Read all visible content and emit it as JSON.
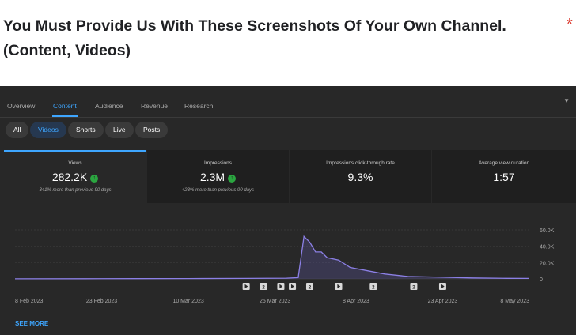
{
  "question": {
    "text": "You Must Provide Us With These Screenshots Of Your Own Channel. (Content, Videos)",
    "required_mark": "*"
  },
  "studio": {
    "tabs": [
      "Overview",
      "Content",
      "Audience",
      "Revenue",
      "Research"
    ],
    "active_tab": "Content",
    "chips": [
      "All",
      "Videos",
      "Shorts",
      "Live",
      "Posts"
    ],
    "active_chip": "Videos",
    "metrics": [
      {
        "title": "Views",
        "value": "282.2K",
        "trend": "up",
        "sub": "341% more than previous 90 days"
      },
      {
        "title": "Impressions",
        "value": "2.3M",
        "trend": "up",
        "sub": "423% more than previous 90 days"
      },
      {
        "title": "Impressions click-through rate",
        "value": "9.3%"
      },
      {
        "title": "Average view duration",
        "value": "1:57"
      }
    ],
    "see_more": "SEE MORE",
    "colors": {
      "accent": "#3ea6ff",
      "trend_up": "#2ba640",
      "line": "#8c80e6"
    }
  },
  "chart_data": {
    "type": "area",
    "x_tick_labels": [
      "8 Feb 2023",
      "23 Feb 2023",
      "10 Mar 2023",
      "25 Mar 2023",
      "8 Apr 2023",
      "23 Apr 2023",
      "8 May 2023"
    ],
    "y_tick_labels": [
      "60.0K",
      "40.0K",
      "20.0K",
      "0"
    ],
    "ylim": [
      0,
      60000
    ],
    "grid": true,
    "series": [
      {
        "x": [
          "2023-02-08",
          "2023-02-20",
          "2023-03-01",
          "2023-03-10",
          "2023-03-20",
          "2023-03-27",
          "2023-03-29",
          "2023-03-30",
          "2023-03-31",
          "2023-04-01",
          "2023-04-02",
          "2023-04-03",
          "2023-04-05",
          "2023-04-07",
          "2023-04-10",
          "2023-04-13",
          "2023-04-17",
          "2023-04-20",
          "2023-04-23",
          "2023-04-28",
          "2023-05-04",
          "2023-05-08"
        ],
        "y": [
          100,
          200,
          300,
          400,
          600,
          900,
          1500,
          52000,
          45000,
          33000,
          33000,
          26000,
          23000,
          14000,
          10000,
          6000,
          3000,
          2500,
          2000,
          1200,
          700,
          600
        ]
      }
    ],
    "markers": [
      {
        "x": "2023-03-20",
        "label": ""
      },
      {
        "x": "2023-03-23",
        "label": "2"
      },
      {
        "x": "2023-03-26",
        "label": ""
      },
      {
        "x": "2023-03-28",
        "label": ""
      },
      {
        "x": "2023-03-31",
        "label": "2"
      },
      {
        "x": "2023-04-05",
        "label": ""
      },
      {
        "x": "2023-04-11",
        "label": "2"
      },
      {
        "x": "2023-04-18",
        "label": "2"
      },
      {
        "x": "2023-04-23",
        "label": ""
      }
    ]
  }
}
